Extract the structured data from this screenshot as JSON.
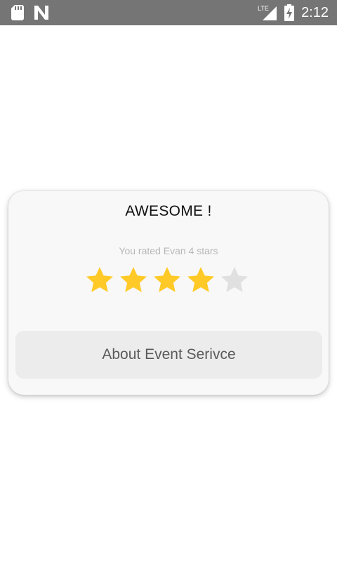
{
  "status_bar": {
    "time": "2:12",
    "network_label": "LTE",
    "icons": [
      "sd-card-icon",
      "n-notification-icon",
      "lte-signal-icon",
      "battery-charging-icon"
    ]
  },
  "rating_card": {
    "title": "AWESOME !",
    "subtitle": "You rated Evan 4 stars",
    "rating": 4,
    "max_rating": 5,
    "star_filled_color": "#FFCA28",
    "star_empty_color": "#E0E0E0",
    "button_label": "About Event Serivce"
  }
}
